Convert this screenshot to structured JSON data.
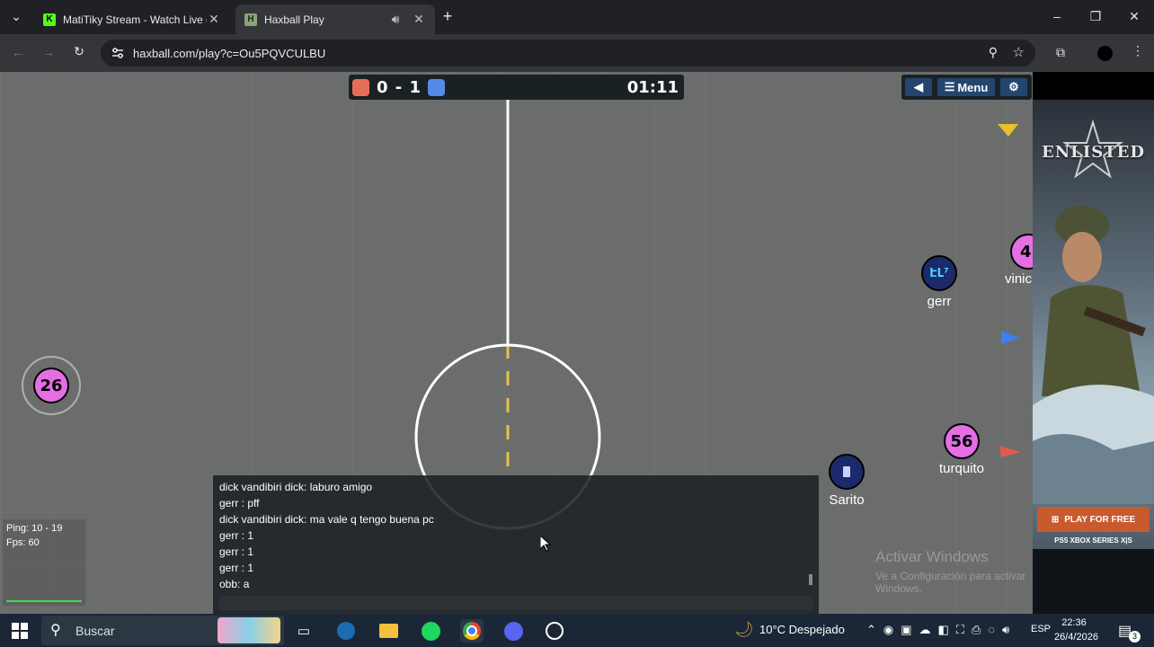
{
  "browser": {
    "tabs": [
      {
        "title": "MatiTiky Stream - Watch Live o",
        "favicon": "K",
        "active": false
      },
      {
        "title": "Haxball Play",
        "favicon": "H",
        "active": true
      }
    ],
    "url": "haxball.com/play?c=Ou5PQVCULBU",
    "new_tab": "+",
    "window_controls": {
      "minimize": "–",
      "maximize": "❐",
      "close": "✕"
    }
  },
  "game": {
    "score": "0 - 1",
    "red_color": "#e56e56",
    "blue_color": "#5689e5",
    "timer": "01:11",
    "menu_label": "Menu",
    "players": [
      {
        "label": "26",
        "name": "",
        "team": "red"
      },
      {
        "label": "56",
        "name": "turquito",
        "team": "red"
      },
      {
        "label": "4",
        "name": "vinic",
        "team": "red"
      },
      {
        "label": "ԷԼ⁷",
        "name": "gerr",
        "team": "blue"
      },
      {
        "label": "",
        "name": "Sarito",
        "team": "blue"
      }
    ],
    "ping": "Ping: 10 - 19",
    "fps": "Fps: 60",
    "chat": [
      "dick vandibiri dick: laburo amigo",
      "gerr : pff",
      "dick vandibiri dick: ma vale q tengo buena pc",
      "gerr : 1",
      "gerr : 1",
      "gerr : 1",
      "obb: a"
    ]
  },
  "watermark": {
    "line1": "Activar Windows",
    "line2": "Ve a Configuración para activar Windows."
  },
  "ad": {
    "logo": "ENLISTED",
    "cta": "PLAY FOR FREE",
    "platforms": "PS5   XBOX SERIES X|S"
  },
  "taskbar": {
    "search_placeholder": "Buscar",
    "weather": "10°C  Despejado",
    "lang": "ESP",
    "time": "22:36",
    "date": "26/4/2026",
    "notif_count": "3"
  }
}
